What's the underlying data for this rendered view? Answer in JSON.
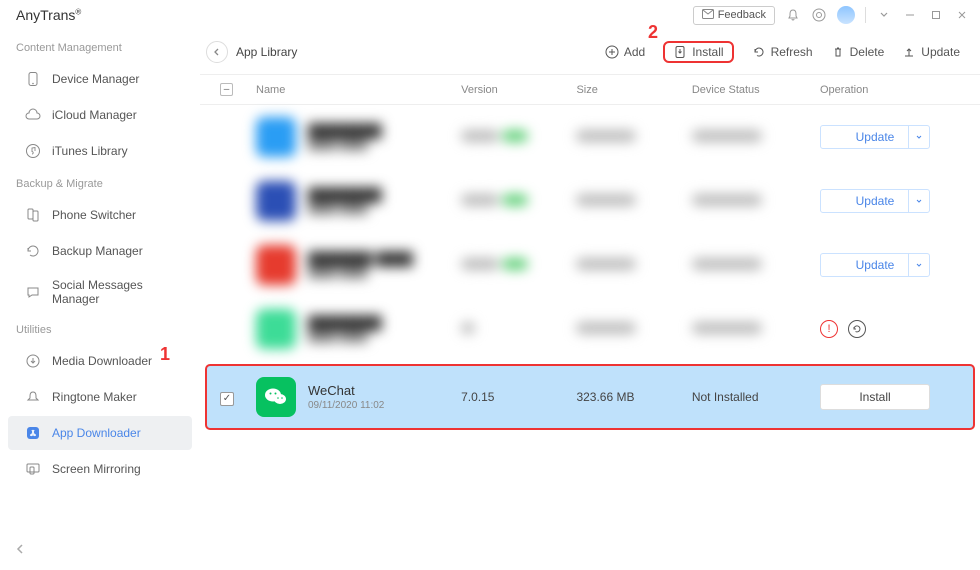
{
  "app": {
    "title": "AnyTrans",
    "trademark": "®"
  },
  "titlebar": {
    "feedback": "Feedback"
  },
  "sidebar": {
    "sections": [
      {
        "label": "Content Management",
        "items": [
          {
            "label": "Device Manager"
          },
          {
            "label": "iCloud Manager"
          },
          {
            "label": "iTunes Library"
          }
        ]
      },
      {
        "label": "Backup & Migrate",
        "items": [
          {
            "label": "Phone Switcher"
          },
          {
            "label": "Backup Manager"
          },
          {
            "label": "Social Messages Manager"
          }
        ]
      },
      {
        "label": "Utilities",
        "items": [
          {
            "label": "Media Downloader"
          },
          {
            "label": "Ringtone Maker"
          },
          {
            "label": "App Downloader"
          },
          {
            "label": "Screen Mirroring"
          }
        ]
      }
    ]
  },
  "toolbar": {
    "breadcrumb": "App Library",
    "add": "Add",
    "install": "Install",
    "refresh": "Refresh",
    "delete": "Delete",
    "update": "Update"
  },
  "table": {
    "headers": {
      "name": "Name",
      "version": "Version",
      "size": "Size",
      "status": "Device Status",
      "op": "Operation"
    },
    "rows": [
      {
        "blurred": true,
        "action": "update"
      },
      {
        "blurred": true,
        "action": "update"
      },
      {
        "blurred": true,
        "action": "update"
      },
      {
        "blurred": true,
        "action": "warn"
      },
      {
        "blurred": false,
        "selected": true,
        "checked": true,
        "name": "WeChat",
        "date": "09/11/2020 11:02",
        "version": "7.0.15",
        "size": "323.66 MB",
        "status": "Not Installed",
        "action": "install"
      }
    ],
    "update_label": "Update",
    "install_label": "Install"
  },
  "annotations": {
    "one": "1",
    "two": "2"
  }
}
